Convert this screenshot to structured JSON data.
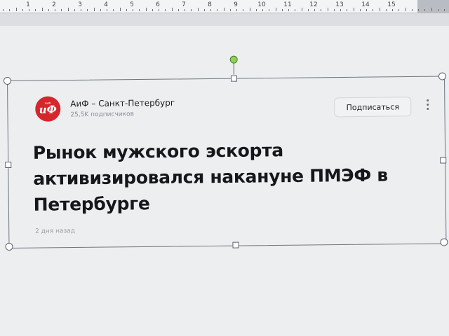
{
  "ruler": {
    "numbers": [
      "1",
      "2",
      "3",
      "4",
      "5",
      "6",
      "7",
      "8",
      "9",
      "10",
      "11",
      "12",
      "13",
      "14",
      "15"
    ]
  },
  "card": {
    "source_name": "АиФ – Санкт-Петербург",
    "subscribers": "25,5K подписчиков",
    "subscribe_label": "Подписаться",
    "headline": "Рынок мужского эскорта активизировался накануне ПМЭФ в Петербурге",
    "time_ago": "2 дня назад",
    "logo_text": "иФ",
    "logo_small_text": "АиФ",
    "accent_color": "#d6262d"
  },
  "icons": {
    "more": "more-vertical-icon",
    "logo": "aif-logo-icon"
  }
}
